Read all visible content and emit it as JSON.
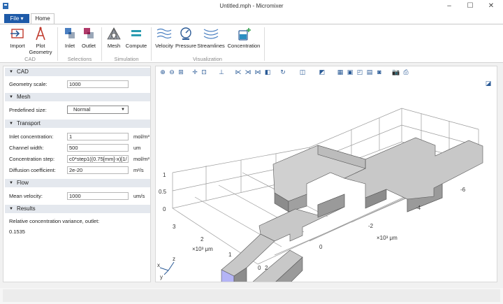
{
  "window": {
    "title": "Untitled.mph - Micromixer",
    "controls": [
      "–",
      "☐",
      "✕"
    ]
  },
  "menu": {
    "file_label": "File ▾",
    "tabs": [
      "Home"
    ]
  },
  "ribbon": {
    "groups": [
      {
        "name": "CAD",
        "items": [
          "Import",
          "Plot\nGeometry"
        ]
      },
      {
        "name": "Selections",
        "items": [
          "Inlet",
          "Outlet"
        ]
      },
      {
        "name": "Simulation",
        "items": [
          "Mesh",
          "Compute"
        ]
      },
      {
        "name": "Visualization",
        "items": [
          "Velocity",
          "Pressure",
          "Streamlines",
          "Concentration"
        ]
      }
    ],
    "labels": {
      "import": "Import",
      "plot_geometry_1": "Plot",
      "plot_geometry_2": "Geometry",
      "inlet": "Inlet",
      "outlet": "Outlet",
      "mesh": "Mesh",
      "compute": "Compute",
      "velocity": "Velocity",
      "pressure": "Pressure",
      "streamlines": "Streamlines",
      "concentration": "Concentration",
      "group_cad": "CAD",
      "group_selections": "Selections",
      "group_simulation": "Simulation",
      "group_visualization": "Visualization"
    }
  },
  "panel": {
    "cad": {
      "header": "CAD",
      "geometry_scale_label": "Geometry scale:",
      "geometry_scale_value": "1000"
    },
    "mesh": {
      "header": "Mesh",
      "predefined_size_label": "Predefined size:",
      "predefined_size_value": "Normal"
    },
    "transport": {
      "header": "Transport",
      "inlet_concentration_label": "Inlet concentration:",
      "inlet_concentration_value": "1",
      "inlet_concentration_unit": "mol/m³",
      "channel_width_label": "Channel width:",
      "channel_width_value": "500",
      "channel_width_unit": "um",
      "concentration_step_label": "Concentration step:",
      "concentration_step_value": "c0*step1((0.75[mm]-x)[1/",
      "concentration_step_unit": "mol/m³",
      "diffusion_coefficient_label": "Diffusion coefficient:",
      "diffusion_coefficient_value": "2e-20",
      "diffusion_coefficient_unit": "m²/s"
    },
    "flow": {
      "header": "Flow",
      "mean_velocity_label": "Mean velocity:",
      "mean_velocity_value": "1000",
      "mean_velocity_unit": "um/s"
    },
    "results": {
      "header": "Results",
      "variance_label": "Relative concentration variance, outlet:",
      "variance_value": "0.1535"
    }
  },
  "graphics": {
    "toolbar_icons": [
      "zoom-in-icon",
      "zoom-out-icon",
      "zoom-box-icon",
      "zoom-extents-icon",
      "fit-icon",
      "axes-icon",
      "view-xy-icon",
      "view-yz-icon",
      "view-xz-icon",
      "scene-light-icon",
      "rotate-icon",
      "camera-icon",
      "render-icon",
      "grid-icon",
      "wireframe-icon",
      "transparency-icon",
      "select-icon",
      "screenshot-icon",
      "print-icon"
    ],
    "axis": {
      "z_ticks": [
        "1",
        "0.5",
        "0"
      ],
      "y_ticks": [
        "3",
        "2",
        "1",
        "0"
      ],
      "x_ticks": [
        "2",
        "0",
        "-2",
        "-4",
        "-6"
      ],
      "y_label": "×10³ μm",
      "x_label": "×10³ μm",
      "triad": [
        "z",
        "x",
        "y"
      ]
    },
    "colors": {
      "channel_top": "#c8c8c8",
      "channel_side": "#8c8c8c",
      "inlet_face": "#b4b4f6"
    }
  }
}
